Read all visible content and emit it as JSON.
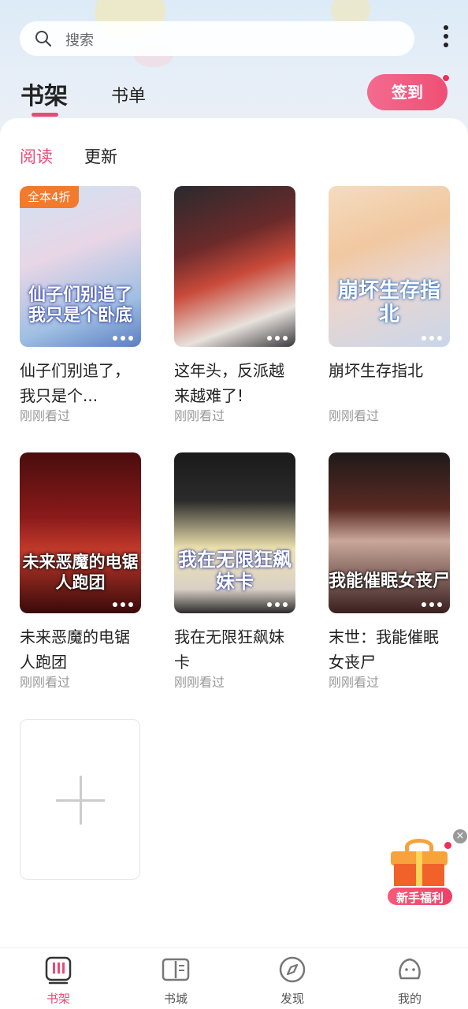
{
  "search": {
    "placeholder": "搜索"
  },
  "header": {
    "tabs": [
      {
        "label": "书架",
        "active": true
      },
      {
        "label": "书单",
        "active": false
      }
    ],
    "signin_label": "签到"
  },
  "subtabs": [
    {
      "label": "阅读",
      "active": true
    },
    {
      "label": "更新",
      "active": false
    }
  ],
  "books": [
    {
      "title": "仙子们别追了，我只是个...",
      "cover_text": "仙子们别追了我只是个卧底",
      "badge": "全本4折",
      "status": "刚刚看过"
    },
    {
      "title": "这年头，反派越来越难了!",
      "cover_text": "",
      "badge": "",
      "status": "刚刚看过"
    },
    {
      "title": "崩坏生存指北",
      "cover_text": "崩坏生存指北",
      "badge": "",
      "status": "刚刚看过"
    },
    {
      "title": "未来恶魔的电锯人跑团",
      "cover_text": "未来恶魔的电锯人跑团",
      "badge": "",
      "status": "刚刚看过"
    },
    {
      "title": "我在无限狂飙妹卡",
      "cover_text": "我在无限狂飙妹卡",
      "badge": "",
      "status": "刚刚看过"
    },
    {
      "title": "末世：我能催眠女丧尸",
      "cover_text": "我能催眠女丧尸",
      "badge": "",
      "status": "刚刚看过"
    }
  ],
  "gift": {
    "label": "新手福利",
    "close": "×"
  },
  "bottom_nav": [
    {
      "label": "书架",
      "icon": "bookshelf-icon",
      "active": true
    },
    {
      "label": "书城",
      "icon": "book-store-icon",
      "active": false
    },
    {
      "label": "发现",
      "icon": "compass-icon",
      "active": false
    },
    {
      "label": "我的",
      "icon": "profile-icon",
      "active": false
    }
  ],
  "colors": {
    "accent": "#e94b76",
    "badge": "#f37a2d"
  }
}
